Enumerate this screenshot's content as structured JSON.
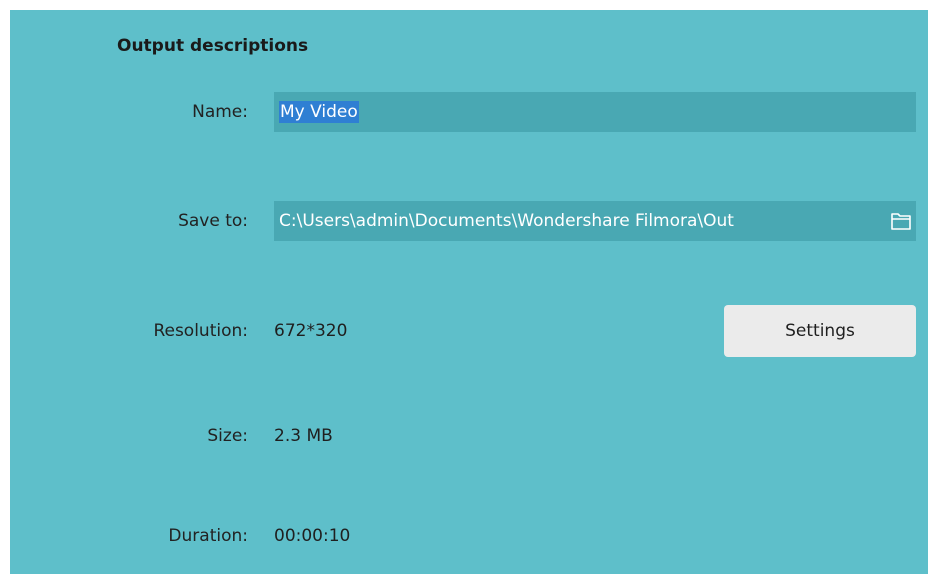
{
  "section": {
    "title": "Output descriptions"
  },
  "fields": {
    "name": {
      "label": "Name:",
      "value": "My Video"
    },
    "save_to": {
      "label": "Save to:",
      "value": "C:\\Users\\admin\\Documents\\Wondershare Filmora\\Out",
      "icon": "folder-icon"
    },
    "resolution": {
      "label": "Resolution:",
      "value": "672*320"
    },
    "size": {
      "label": "Size:",
      "value": "2.3 MB"
    },
    "duration": {
      "label": "Duration:",
      "value": "00:00:10"
    }
  },
  "buttons": {
    "settings": "Settings"
  },
  "colors": {
    "panel_bg": "#5ebfca",
    "field_bg": "#49a8b3",
    "selection": "#2f7fd3",
    "button_bg": "#ebebeb"
  }
}
